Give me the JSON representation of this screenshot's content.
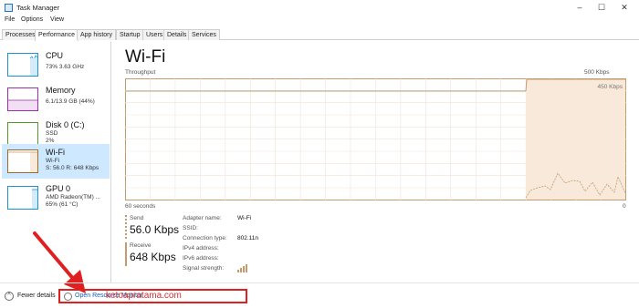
{
  "window": {
    "title": "Task Manager"
  },
  "menu": [
    "File",
    "Options",
    "View"
  ],
  "tabs": [
    "Processes",
    "Performance",
    "App history",
    "Startup",
    "Users",
    "Details",
    "Services"
  ],
  "sidebar": {
    "items": [
      {
        "name": "CPU",
        "line1": "73% 3.63 GHz",
        "line2": "",
        "color": "#1f8fd6"
      },
      {
        "name": "Memory",
        "line1": "6.1/13.9 GB (44%)",
        "line2": "",
        "color": "#9b30a8"
      },
      {
        "name": "Disk 0 (C:)",
        "line1": "SSD",
        "line2": "2%",
        "color": "#4f9a2a"
      },
      {
        "name": "Wi-Fi",
        "line1": "Wi-Fi",
        "line2": "S: 56.0 R: 648 Kbps",
        "color": "#a06a2c"
      },
      {
        "name": "GPU 0",
        "line1": "AMD Radeon(TM) ...",
        "line2": "65% (61 °C)",
        "color": "#1f8fd6"
      }
    ]
  },
  "main": {
    "title": "Wi-Fi",
    "throughput_label": "Throughput",
    "max_label": "500 Kbps",
    "inner_label": "450 Kbps",
    "time_label": "60 seconds",
    "zero_label": "0",
    "send": {
      "label": "Send",
      "value": "56.0 Kbps"
    },
    "receive": {
      "label": "Receive",
      "value": "648 Kbps"
    },
    "properties": [
      {
        "key": "Adapter name:",
        "value": "Wi-Fi"
      },
      {
        "key": "SSID:",
        "value": ""
      },
      {
        "key": "Connection type:",
        "value": "802.11n"
      },
      {
        "key": "IPv4 address:",
        "value": ""
      },
      {
        "key": "IPv6 address:",
        "value": ""
      },
      {
        "key": "Signal strength:",
        "value": ""
      }
    ]
  },
  "footer": {
    "fewer_details": "Fewer details",
    "resource_monitor": "Open Resource Monitor",
    "watermark": "ketoapratama.com"
  },
  "colors": {
    "accent_brown": "#a06a2c",
    "graph_fill": "#f8e9db",
    "highlight_red": "#e02020"
  }
}
